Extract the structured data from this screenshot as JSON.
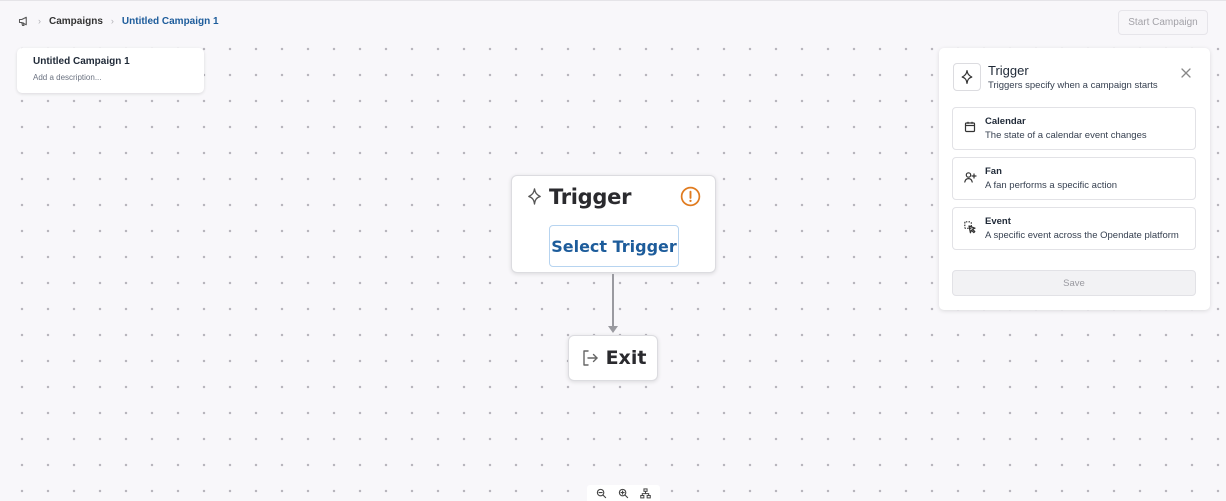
{
  "breadcrumb": {
    "home_icon": "megaphone-icon",
    "items": [
      "Campaigns",
      "Untitled Campaign 1"
    ]
  },
  "header": {
    "start_button": "Start Campaign"
  },
  "campaign": {
    "title": "Untitled Campaign 1",
    "description_placeholder": "Add a description..."
  },
  "trigger_node": {
    "icon": "sparkle-icon",
    "title": "Trigger",
    "warning_icon": "warning-circle-icon",
    "button": "Select Trigger"
  },
  "exit_node": {
    "icon": "exit-icon",
    "label": "Exit"
  },
  "panel": {
    "icon": "sparkle-icon",
    "title": "Trigger",
    "subtitle": "Triggers specify when a campaign starts",
    "options": [
      {
        "icon": "calendar-icon",
        "title": "Calendar",
        "description": "The state of a calendar event changes"
      },
      {
        "icon": "user-plus-icon",
        "title": "Fan",
        "description": "A fan performs a specific action"
      },
      {
        "icon": "cursor-click-icon",
        "title": "Event",
        "description": "A specific event across the Opendate platform"
      }
    ],
    "save": "Save"
  },
  "zoom_controls": [
    "zoom-out-icon",
    "zoom-in-icon",
    "fit-view-icon"
  ],
  "colors": {
    "accent": "#1d5c9b",
    "warning": "#e07b1f",
    "canvas": "#f8f7fa"
  }
}
